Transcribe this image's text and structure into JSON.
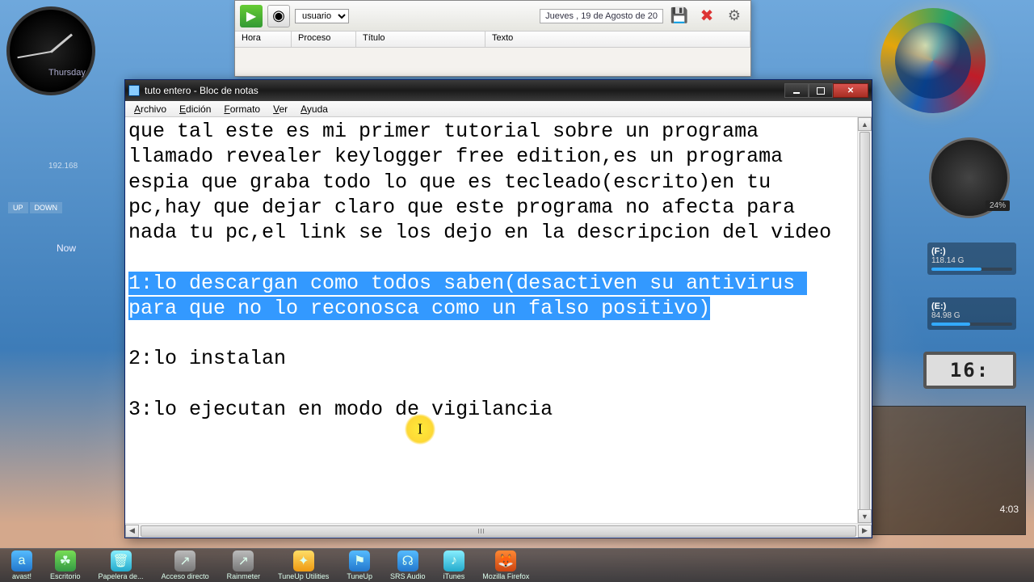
{
  "desktop": {
    "day_label": "Thursday",
    "ip": "192.168",
    "speed_up": "UP",
    "speed_down": "DOWN",
    "now": "Now",
    "cpu_pct": "24%",
    "drive1_label": "(F:)",
    "drive1_size": "118.14 G",
    "drive2_label": "(E:)",
    "drive2_size": "84.98 G",
    "digital_time": "16:",
    "media_time": "4:03"
  },
  "bg_app": {
    "user_dropdown": "usuario",
    "date_text": "Jueves , 19 de   Agosto   de 20",
    "cols": {
      "hora": "Hora",
      "proceso": "Proceso",
      "titulo": "Título",
      "texto": "Texto"
    }
  },
  "notepad": {
    "title": "tuto entero - Bloc de notas",
    "menu": {
      "archivo": "Archivo",
      "edicion": "Edición",
      "formato": "Formato",
      "ver": "Ver",
      "ayuda": "Ayuda"
    },
    "text": {
      "p1": "que tal este es mi primer tutorial sobre un programa llamado revealer keylogger free edition,es un programa espia que graba todo lo que es tecleado(escrito)en tu pc,hay que dejar claro que este programa no afecta para nada tu pc,el link se los dejo en la descripcion del video",
      "sel": "1:lo descargan como todos saben(desactiven su antivirus para que no lo reconosca como un falso positivo)",
      "p2": "2:lo instalan",
      "p3": "3:lo ejecutan en modo de vigilancia"
    }
  },
  "taskbar": {
    "items": [
      {
        "label": "avast!"
      },
      {
        "label": "Escritorio"
      },
      {
        "label": "Papelera de..."
      },
      {
        "label": "Acceso directo"
      },
      {
        "label": "Rainmeter"
      },
      {
        "label": "TuneUp Utilities"
      },
      {
        "label": "TuneUp"
      },
      {
        "label": "SRS Audio"
      },
      {
        "label": "iTunes"
      },
      {
        "label": "Mozilla Firefox"
      }
    ]
  }
}
